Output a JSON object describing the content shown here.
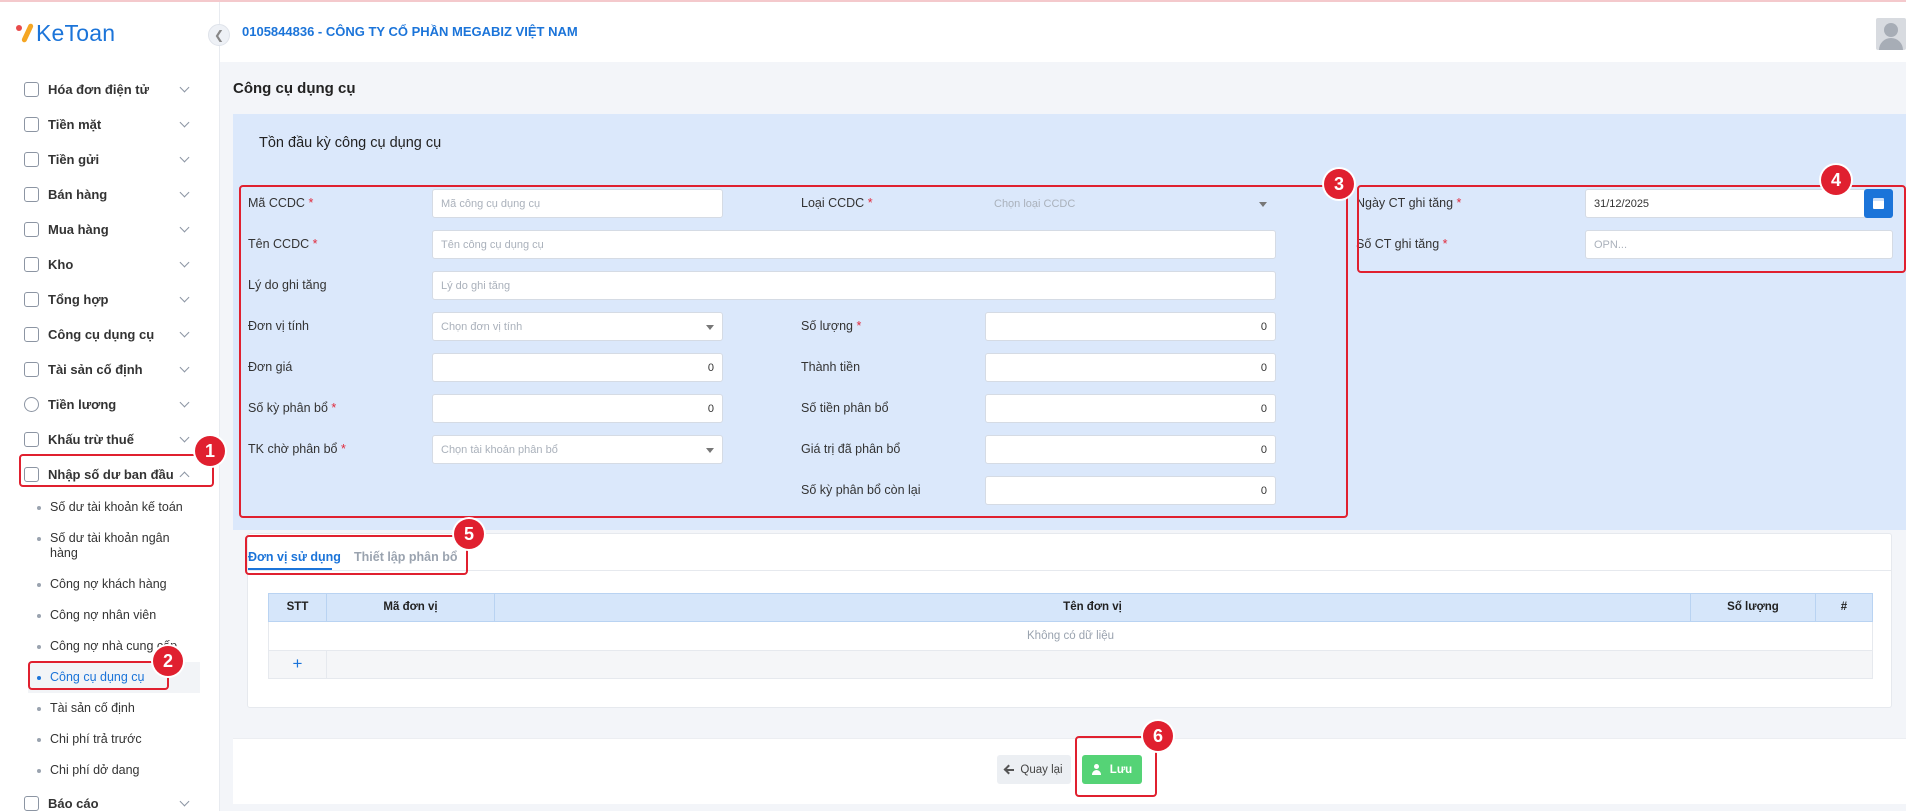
{
  "app": {
    "logo_text": "KeToan"
  },
  "header": {
    "company": "0105844836 - CÔNG TY CỔ PHẦN MEGABIZ VIỆT NAM"
  },
  "sidebar": {
    "items": [
      {
        "label": "Hóa đơn điện tử",
        "icon": "invoice-icon"
      },
      {
        "label": "Tiền mặt",
        "icon": "cash-icon"
      },
      {
        "label": "Tiền gửi",
        "icon": "bank-card-icon"
      },
      {
        "label": "Bán hàng",
        "icon": "sales-icon"
      },
      {
        "label": "Mua hàng",
        "icon": "purchase-icon"
      },
      {
        "label": "Kho",
        "icon": "warehouse-icon"
      },
      {
        "label": "Tổng hợp",
        "icon": "chart-icon"
      },
      {
        "label": "Công cụ dụng cụ",
        "icon": "tools-icon"
      },
      {
        "label": "Tài sản cố định",
        "icon": "car-icon"
      },
      {
        "label": "Tiền lương",
        "icon": "dollar-icon"
      },
      {
        "label": "Khấu trừ thuế",
        "icon": "tax-icon"
      },
      {
        "label": "Nhập số dư ban đầu",
        "icon": "edit-icon"
      }
    ],
    "subitems": [
      "Số dư tài khoản kế toán",
      "Số dư tài khoản ngân hàng",
      "Công nợ khách hàng",
      "Công nợ nhân viên",
      "Công nợ nhà cung cấp",
      "Công cụ dụng cụ",
      "Tài sản cố định",
      "Chi phí trả trước",
      "Chi phí dở dang"
    ],
    "bottom_item": "Báo cáo"
  },
  "page": {
    "title": "Công cụ dụng cụ"
  },
  "form": {
    "title": "Tồn đầu kỳ công cụ dụng cụ",
    "ma_ccdc": {
      "label": "Mã CCDC",
      "placeholder": "Mã công cụ dụng cụ"
    },
    "loai_ccdc": {
      "label": "Loại CCDC",
      "placeholder": "Chọn loại CCDC"
    },
    "ten_ccdc": {
      "label": "Tên CCDC",
      "placeholder": "Tên công cụ dụng cụ"
    },
    "ly_do": {
      "label": "Lý do ghi tăng",
      "placeholder": "Lý do ghi tăng"
    },
    "don_vi_tinh": {
      "label": "Đơn vị tính",
      "placeholder": "Chọn đơn vị tính"
    },
    "so_luong": {
      "label": "Số lượng",
      "value": "0"
    },
    "don_gia": {
      "label": "Đơn giá",
      "value": "0"
    },
    "thanh_tien": {
      "label": "Thành tiền",
      "value": "0"
    },
    "so_ky_phan_bo": {
      "label": "Số kỳ phân bổ",
      "value": "0"
    },
    "so_tien_phan_bo": {
      "label": "Số tiền phân bổ",
      "value": "0"
    },
    "tk_cho_phan_bo": {
      "label": "TK chờ phân bổ",
      "placeholder": "Chọn tài khoản phân bổ"
    },
    "gia_tri_da_phan_bo": {
      "label": "Giá trị đã phân bổ",
      "value": "0"
    },
    "so_ky_con_lai": {
      "label": "Số kỳ phân bổ còn lại",
      "value": "0"
    },
    "ngay_ct": {
      "label": "Ngày CT ghi tăng",
      "value": "31/12/2025"
    },
    "so_ct": {
      "label": "Số CT ghi tăng",
      "placeholder": "OPN..."
    },
    "required_mark": "*"
  },
  "tabs": [
    {
      "label": "Đơn vị sử dụng",
      "active": true
    },
    {
      "label": "Thiết lập phân bổ",
      "active": false
    }
  ],
  "table": {
    "columns": [
      "STT",
      "Mã đơn vị",
      "Tên đơn vị",
      "Số lượng",
      "#"
    ],
    "empty_text": "Không có dữ liệu",
    "add_symbol": "+"
  },
  "footer": {
    "back_label": "Quay lại",
    "save_label": "Lưu"
  },
  "annotations": [
    "1",
    "2",
    "3",
    "4",
    "5",
    "6"
  ],
  "colors": {
    "accent": "#1b74d9",
    "panel": "#dbe8fb",
    "save": "#55d376",
    "annotation": "#e0202f"
  }
}
